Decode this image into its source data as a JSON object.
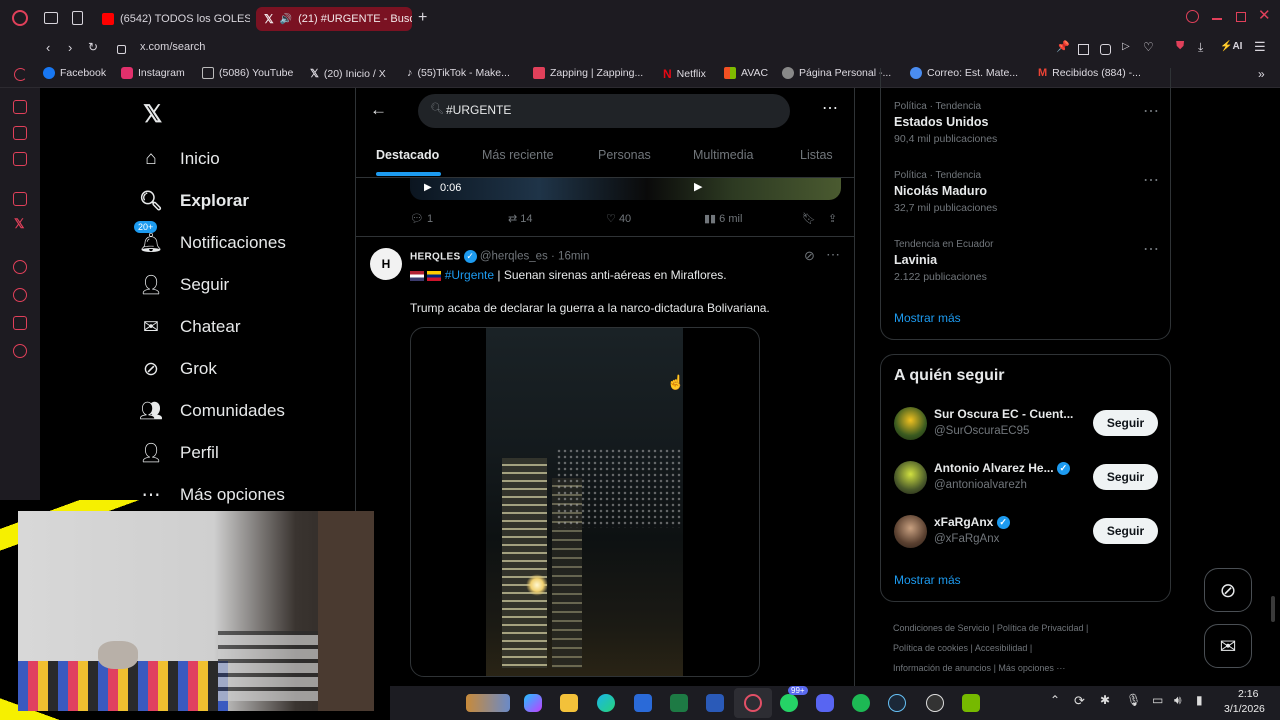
{
  "tabs": [
    {
      "label": "(6542) TODOS los GOLES",
      "icon": "youtube-icon",
      "active": false
    },
    {
      "label": "(21) #URGENTE - Busc",
      "icon": "x-logo-icon",
      "active": true
    }
  ],
  "address": {
    "url": "x.com/search"
  },
  "bookmarks": [
    {
      "label": "Facebook",
      "icon": "facebook-icon",
      "color": "#1877f2"
    },
    {
      "label": "Instagram",
      "icon": "instagram-icon",
      "color": "#e1306c"
    },
    {
      "label": "(5086) YouTube",
      "icon": "page-icon",
      "color": "#888888"
    },
    {
      "label": "(20) Inicio / X",
      "icon": "x-logo-icon",
      "color": "#ffffff"
    },
    {
      "label": "(55)TikTok - Make...",
      "icon": "tiktok-icon",
      "color": "#ffffff"
    },
    {
      "label": "Zapping | Zapping...",
      "icon": "zapping-icon",
      "color": "#e0405a"
    },
    {
      "label": "Netflix",
      "icon": "netflix-icon",
      "color": "#e50914"
    },
    {
      "label": "AVAC",
      "icon": "avac-icon",
      "color": "#f2b705"
    },
    {
      "label": "Página Personal -...",
      "icon": "personal-page-icon",
      "color": "#aaaaaa"
    },
    {
      "label": "Correo: Est. Mate...",
      "icon": "mail-icon",
      "color": "#4a8cf0"
    },
    {
      "label": "Recibidos (884) -...",
      "icon": "gmail-icon",
      "color": "#ea4335"
    }
  ],
  "nav": {
    "items": [
      {
        "label": "Inicio",
        "icon": "home-icon"
      },
      {
        "label": "Explorar",
        "icon": "search-icon"
      },
      {
        "label": "Notificaciones",
        "icon": "bell-icon",
        "badge": "20+"
      },
      {
        "label": "Seguir",
        "icon": "follow-icon"
      },
      {
        "label": "Chatear",
        "icon": "mail-icon"
      },
      {
        "label": "Grok",
        "icon": "grok-icon"
      },
      {
        "label": "Comunidades",
        "icon": "communities-icon"
      },
      {
        "label": "Perfil",
        "icon": "profile-icon"
      },
      {
        "label": "Más opciones",
        "icon": "more-icon"
      }
    ]
  },
  "search": {
    "query": "#URGENTE"
  },
  "search_tabs": [
    "Destacado",
    "Más reciente",
    "Personas",
    "Multimedia",
    "Listas"
  ],
  "prev_post": {
    "video_time": "0:06",
    "replies": "1",
    "reposts": "14",
    "likes": "40",
    "views": "6 mil"
  },
  "post": {
    "name": "HERQLES",
    "handle": "@herqles_es",
    "time": "16min",
    "hashtag": "#Urgente",
    "text1": "| Suenan sirenas anti-aéreas en Miraflores.",
    "text2": "Trump acaba de declarar la guerra a la narco-dictadura Bolivariana."
  },
  "trends": [
    {
      "category": "Política · Tendencia",
      "name": "Estados Unidos",
      "posts": "90,4 mil publicaciones"
    },
    {
      "category": "Política · Tendencia",
      "name": "Nicolás Maduro",
      "posts": "32,7 mil publicaciones"
    },
    {
      "category": "Tendencia en Ecuador",
      "name": "Lavinia",
      "posts": "2.122 publicaciones"
    }
  ],
  "show_more": "Mostrar más",
  "who_to_follow": {
    "title": "A quién seguir",
    "button": "Seguir",
    "accounts": [
      {
        "name": "Sur Oscura EC - Cuent...",
        "handle": "@SurOscuraEC95",
        "verified": false
      },
      {
        "name": "Antonio Alvarez He...",
        "handle": "@antonioalvarezh",
        "verified": true
      },
      {
        "name": "xFaRgAnx",
        "handle": "@xFaRgAnx",
        "verified": true
      }
    ]
  },
  "footer_links": [
    "Condiciones de Servicio",
    "Política de Privacidad",
    "Política de cookies",
    "Accesibilidad",
    "Información de anuncios",
    "Más opciones ···"
  ],
  "taskbar": {
    "time": "2:16",
    "date": "3/1/2026",
    "notif_badge": "99+"
  },
  "colors": {
    "accent": "#1d9bf0",
    "tab_active": "#7a1222",
    "opera_red": "#e0405a"
  }
}
